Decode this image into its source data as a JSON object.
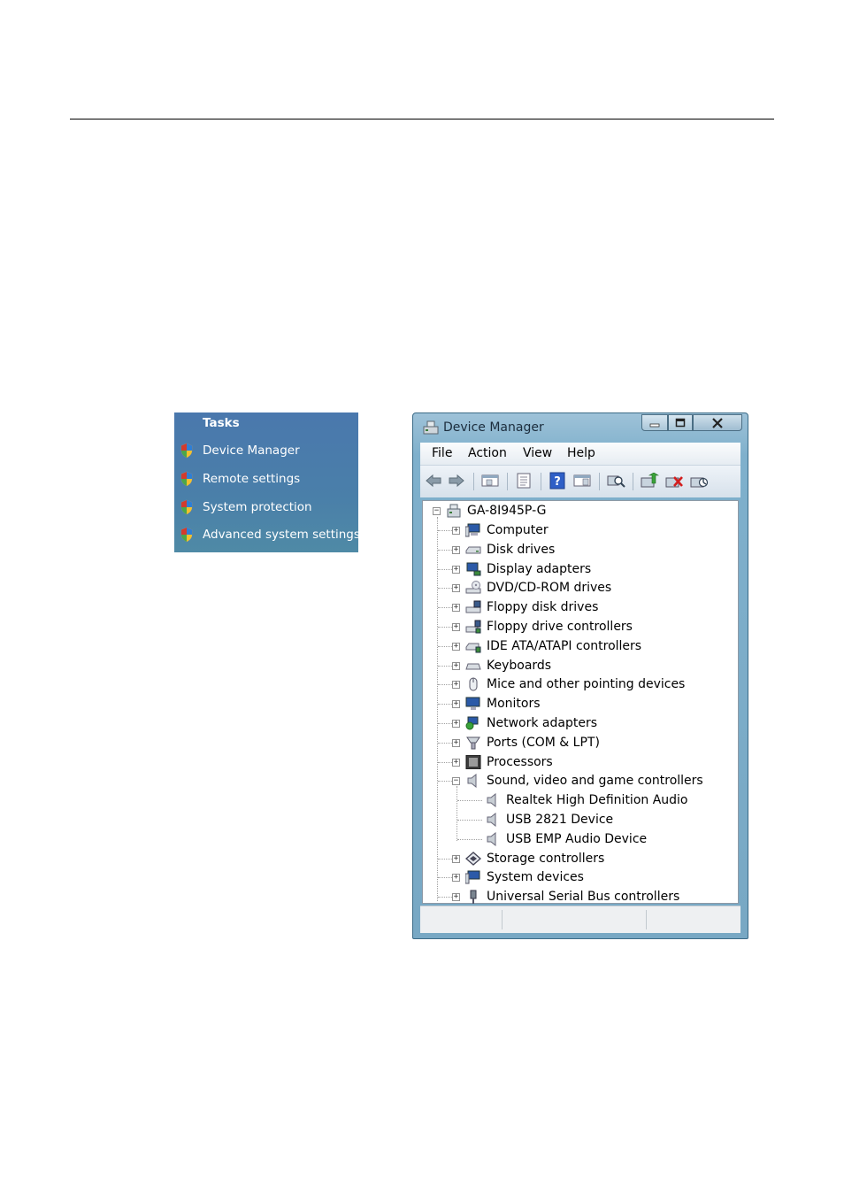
{
  "tasks": {
    "title": "Tasks",
    "items": [
      {
        "label": "Device Manager"
      },
      {
        "label": "Remote settings"
      },
      {
        "label": "System protection"
      },
      {
        "label": "Advanced system settings"
      }
    ]
  },
  "window": {
    "title": "Device Manager",
    "menu": [
      "File",
      "Action",
      "View",
      "Help"
    ],
    "tree": {
      "root": "GA-8I945P-G",
      "categories": [
        "Computer",
        "Disk drives",
        "Display adapters",
        "DVD/CD-ROM drives",
        "Floppy disk drives",
        "Floppy drive controllers",
        "IDE ATA/ATAPI controllers",
        "Keyboards",
        "Mice and other pointing devices",
        "Monitors",
        "Network adapters",
        "Ports (COM & LPT)",
        "Processors",
        "Sound, video and game controllers",
        "Storage controllers",
        "System devices",
        "Universal Serial Bus controllers"
      ],
      "sound_children": [
        "Realtek High Definition Audio",
        "USB 2821 Device",
        "USB EMP Audio Device"
      ]
    }
  },
  "colors": {
    "tasks_bg": "#4a78ad",
    "window_frame": "#7fb0cc"
  }
}
